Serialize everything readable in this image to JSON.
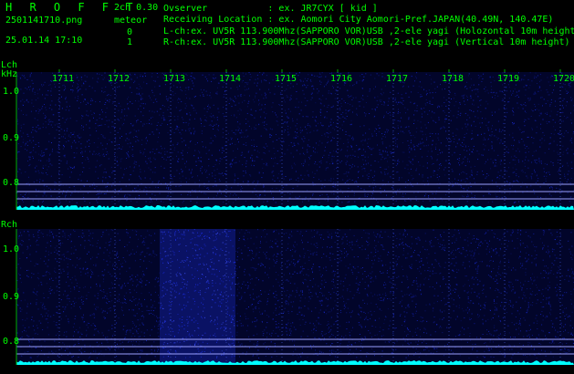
{
  "header": {
    "app_title": "H R O F F T",
    "filename": "2501141710.png",
    "datetime": "25.01.14 17:10",
    "mode": "2ch 0.30",
    "meteor_label": "meteor",
    "lch_meteor_count": "0",
    "rch_meteor_count": "1",
    "info_lines": [
      "Ovserver           : ex. JR7CYX [ kid ]",
      "Receiving Location : ex. Aomori City Aomori-Pref.JAPAN(40.49N, 140.47E)",
      "L-ch:ex. UV5R 113.900Mhz(SAPPORO VOR)USB ,2-ele yagi (Holozontal 10m height)",
      "R-ch:ex. UV5R 113.900Mhz(SAPPORO VOR)USB ,2-ele yagi (Vertical 10m height)"
    ]
  },
  "time_axis": {
    "ticks": [
      "1711",
      "1712",
      "1713",
      "1714",
      "1715",
      "1716",
      "1717",
      "1718",
      "1719",
      "1720"
    ]
  },
  "lch": {
    "label": "Lch",
    "unit": "kHz",
    "y_ticks": [
      "1.0",
      "0.9",
      "0.8"
    ]
  },
  "rch": {
    "label": "Rch",
    "y_ticks": [
      "1.0",
      "0.9",
      "0.8"
    ]
  },
  "colors": {
    "text": "#00ff00",
    "background": "#000000",
    "noise": "#1a2bd8",
    "signal_trace": "#00ffff",
    "ref_line": "#9aa0ff"
  }
}
